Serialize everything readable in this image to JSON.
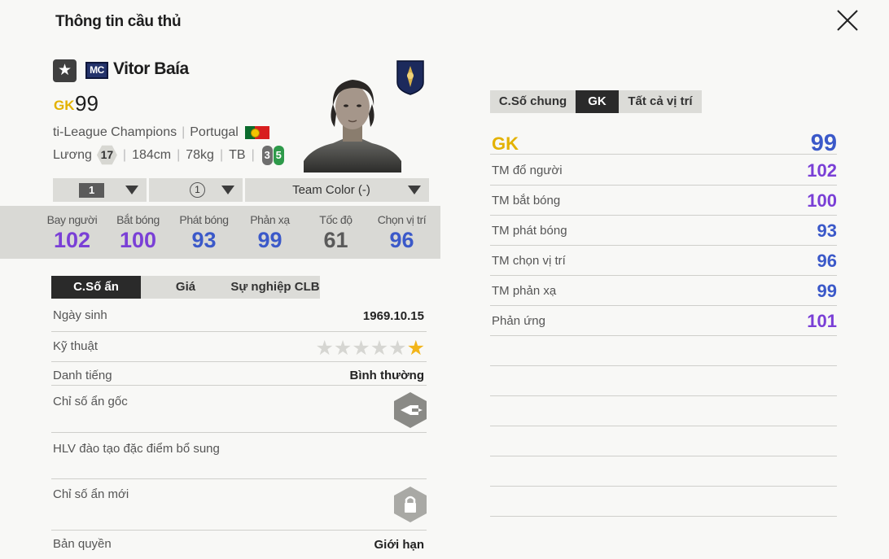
{
  "colors": {
    "gold": "#e3b200",
    "blue": "#3b59c9",
    "purple": "#7a3fd6",
    "gray": "#5a5a5a"
  },
  "header": {
    "title": "Thông tin cầu thủ"
  },
  "player": {
    "season": "MC",
    "name": "Vitor Baía",
    "position": "GK",
    "ovr": "99",
    "league": "ti-League Champions",
    "country": "Portugal",
    "salary_label": "Lương",
    "salary": "17",
    "height": "184cm",
    "weight": "78kg",
    "body": "TB",
    "weak_foot": "3",
    "strong_foot": "5"
  },
  "controls": {
    "level": "1",
    "upgrade": "1",
    "team_color": "Team Color (-)"
  },
  "main_stats": [
    {
      "label": "Bay người",
      "value": "102",
      "color": "#7a3fd6"
    },
    {
      "label": "Bắt bóng",
      "value": "100",
      "color": "#7a3fd6"
    },
    {
      "label": "Phát bóng",
      "value": "93",
      "color": "#3b59c9"
    },
    {
      "label": "Phản xạ",
      "value": "99",
      "color": "#3b59c9"
    },
    {
      "label": "Tốc độ",
      "value": "61",
      "color": "#5a5a5a"
    },
    {
      "label": "Chọn vị trí",
      "value": "96",
      "color": "#3b59c9"
    }
  ],
  "left_tabs": [
    "C.Số ẩn",
    "Giá",
    "Sự nghiệp CLB"
  ],
  "details": {
    "birth_label": "Ngày sinh",
    "birth": "1969.10.15",
    "skill_label": "Kỹ thuật",
    "skill_stars": 1,
    "fame_label": "Danh tiếng",
    "fame": "Bình thường",
    "hidden_label": "Chỉ số ẩn gốc",
    "coach_label": "HLV đào tạo đặc điểm bổ sung",
    "new_hidden_label": "Chỉ số ẩn mới",
    "copyright_label": "Bản quyền",
    "copyright": "Giới hạn"
  },
  "right_tabs": [
    "C.Số chung",
    "GK",
    "Tất cả vị trí"
  ],
  "position_summary": {
    "label": "GK",
    "value": "99"
  },
  "position_stats": [
    {
      "label": "TM đổ người",
      "value": "102",
      "color": "#7a3fd6"
    },
    {
      "label": "TM bắt bóng",
      "value": "100",
      "color": "#7a3fd6"
    },
    {
      "label": "TM phát bóng",
      "value": "93",
      "color": "#3b59c9"
    },
    {
      "label": "TM chọn vị trí",
      "value": "96",
      "color": "#3b59c9"
    },
    {
      "label": "TM phản xạ",
      "value": "99",
      "color": "#3b59c9"
    },
    {
      "label": "Phản ứng",
      "value": "101",
      "color": "#7a3fd6"
    }
  ]
}
